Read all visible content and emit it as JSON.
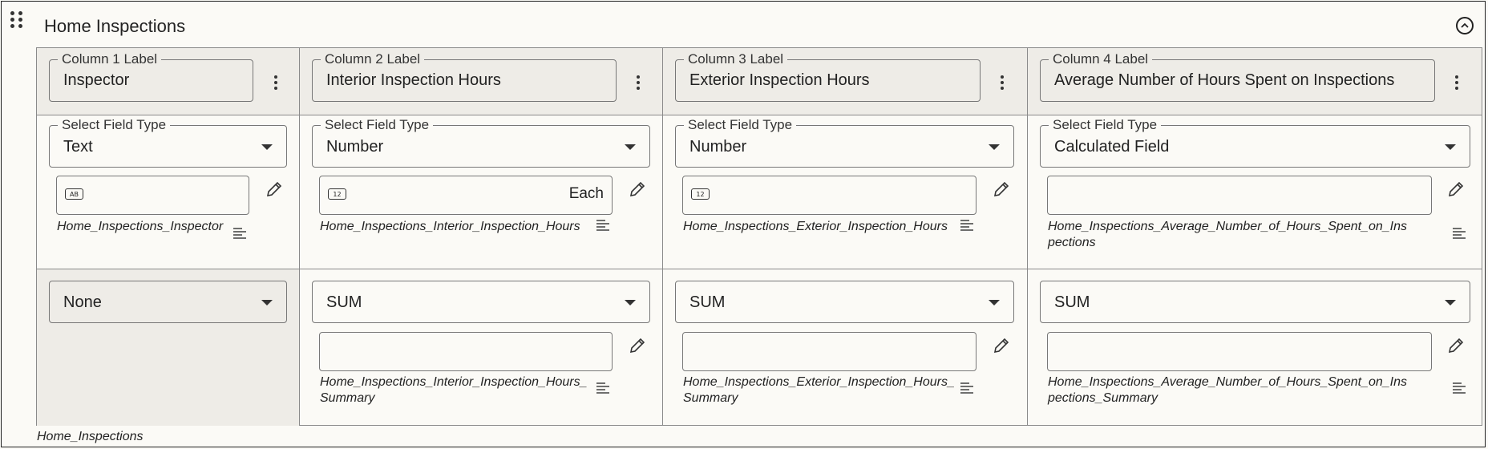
{
  "section": {
    "title": "Home Inspections",
    "footer_name": "Home_Inspections"
  },
  "labels": {
    "select_field_type": "Select Field Type"
  },
  "columns": [
    {
      "legend": "Column 1 Label",
      "label": "Inspector",
      "field_type": "Text",
      "input_badge": "AB",
      "input_unit": "",
      "field_name": "Home_Inspections_Inspector",
      "summary": "None"
    },
    {
      "legend": "Column 2 Label",
      "label": "Interior Inspection Hours",
      "field_type": "Number",
      "input_badge": "12",
      "input_unit": "Each",
      "field_name": "Home_Inspections_Interior_Inspection_Hours",
      "summary": "SUM",
      "summary_field_name": "Home_Inspections_Interior_Inspection_Hours_Summary"
    },
    {
      "legend": "Column 3 Label",
      "label": "Exterior Inspection Hours",
      "field_type": "Number",
      "input_badge": "12",
      "input_unit": "",
      "field_name": "Home_Inspections_Exterior_Inspection_Hours",
      "summary": "SUM",
      "summary_field_name": "Home_Inspections_Exterior_Inspection_Hours_Summary"
    },
    {
      "legend": "Column 4 Label",
      "label": "Average Number of Hours Spent on Inspections",
      "field_type": "Calculated Field",
      "input_badge": "",
      "input_unit": "",
      "field_name": "Home_Inspections_Average_Number_of_Hours_Spent_on_Inspections",
      "summary": "SUM",
      "summary_field_name": "Home_Inspections_Average_Number_of_Hours_Spent_on_Inspections_Summary"
    }
  ]
}
